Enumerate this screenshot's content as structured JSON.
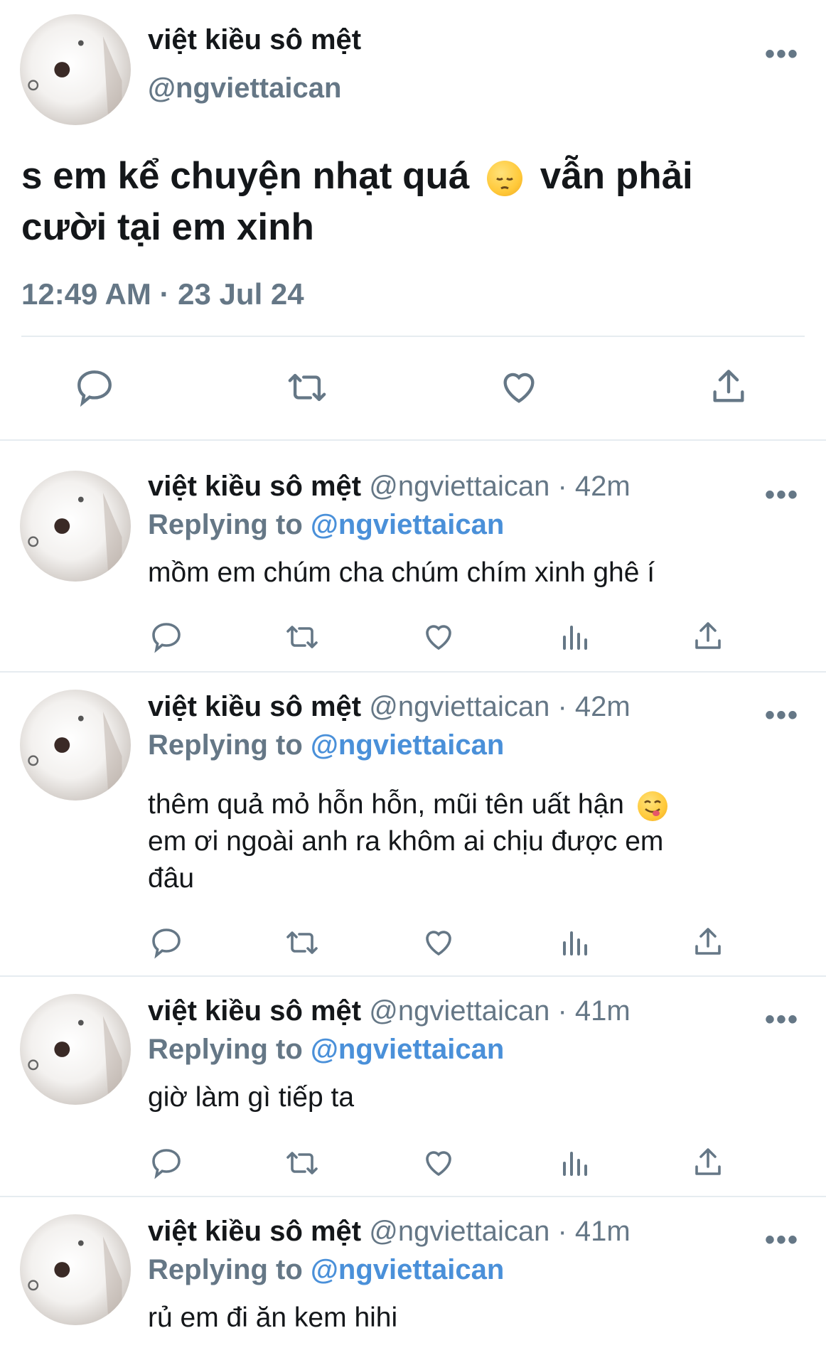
{
  "main_tweet": {
    "display_name": "việt kiều sô mệt",
    "handle": "@ngviettaican",
    "text_line1": "s em kể chuyện nhạt quá",
    "text_line1b": "vẫn phải",
    "text_line2": "cười tại em xinh",
    "emoji": "pensive-face",
    "timestamp": "12:49 AM · 23 Jul 24",
    "more": "•••",
    "actions": [
      "reply-icon",
      "retweet-icon",
      "like-icon",
      "share-icon"
    ]
  },
  "replies": [
    {
      "display_name": "việt kiều sô mệt",
      "meta": "@ngviettaican · 42m",
      "replying_label": "Replying to",
      "replying_to": "@ngviettaican",
      "lines": [
        "mồm em chúm cha chúm chím xinh ghê í"
      ],
      "more": "•••"
    },
    {
      "display_name": "việt kiều sô mệt",
      "meta": "@ngviettaican · 42m",
      "replying_label": "Replying to",
      "replying_to": "@ngviettaican",
      "lines": [
        "thêm quả mỏ hỗn hỗn, mũi tên uất hận",
        "em ơi ngoài anh ra khôm ai chịu được em",
        "đâu"
      ],
      "emoji": "face-savoring-food",
      "more": "•••"
    },
    {
      "display_name": "việt kiều sô mệt",
      "meta": "@ngviettaican · 41m",
      "replying_label": "Replying to",
      "replying_to": "@ngviettaican",
      "lines": [
        "giờ làm gì tiếp ta"
      ],
      "more": "•••"
    },
    {
      "display_name": "việt kiều sô mệt",
      "meta": "@ngviettaican · 41m",
      "replying_label": "Replying to",
      "replying_to": "@ngviettaican",
      "lines": [
        "rủ em đi ăn kem hihi"
      ],
      "more": "•••"
    }
  ],
  "colors": {
    "text": "#14171a",
    "secondary": "#657786",
    "link": "#4a90d9",
    "divider": "#e6ecf0"
  }
}
